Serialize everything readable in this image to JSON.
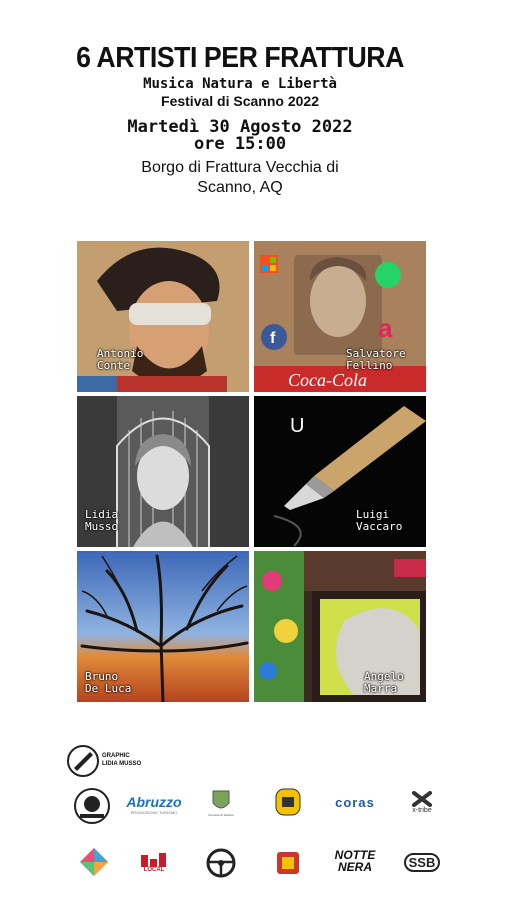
{
  "poster": {
    "title": "6 ARTISTI PER FRATTURA",
    "subtitle": "Musica Natura e Libertà",
    "festival": "Festival di Scanno 2022",
    "date": "Martedì 30 Agosto 2022",
    "time": "ore 15:00",
    "place_line1": "Borgo di Frattura Vecchia di",
    "place_line2": "Scanno, AQ"
  },
  "artists": [
    {
      "first": "Antonio",
      "last": "Conte"
    },
    {
      "first": "Salvatore",
      "last": "Fellino"
    },
    {
      "first": "Lidia",
      "last": "Musso"
    },
    {
      "first": "Luigi",
      "last": "Vaccaro"
    },
    {
      "first": "Bruno",
      "last": "De Luca"
    },
    {
      "first": "Angelo",
      "last": "Marra"
    }
  ],
  "tile_text": {
    "coca_cola": "Coca-Cola",
    "letter_u": "U"
  },
  "sponsors": {
    "graphic_line1": "GRAPHIC",
    "graphic_line2": "LIDIA MUSSO",
    "abruzzo": "Abruzzo",
    "abruzzo_sub": "PROMOZIONE TURISMO",
    "comune": "Comune di Scanno",
    "coras": "coras",
    "xtribe": "x-tribe",
    "local": "LOCAL",
    "nottenera_1": "NOTTE",
    "nottenera_2": "NERA",
    "ssb": "SSB"
  },
  "colors": {
    "abruzzo_blue": "#1f6fc0",
    "coras_blue": "#1e5aa8",
    "local_red": "#c81e2a",
    "festival_yellow": "#f2c200"
  }
}
